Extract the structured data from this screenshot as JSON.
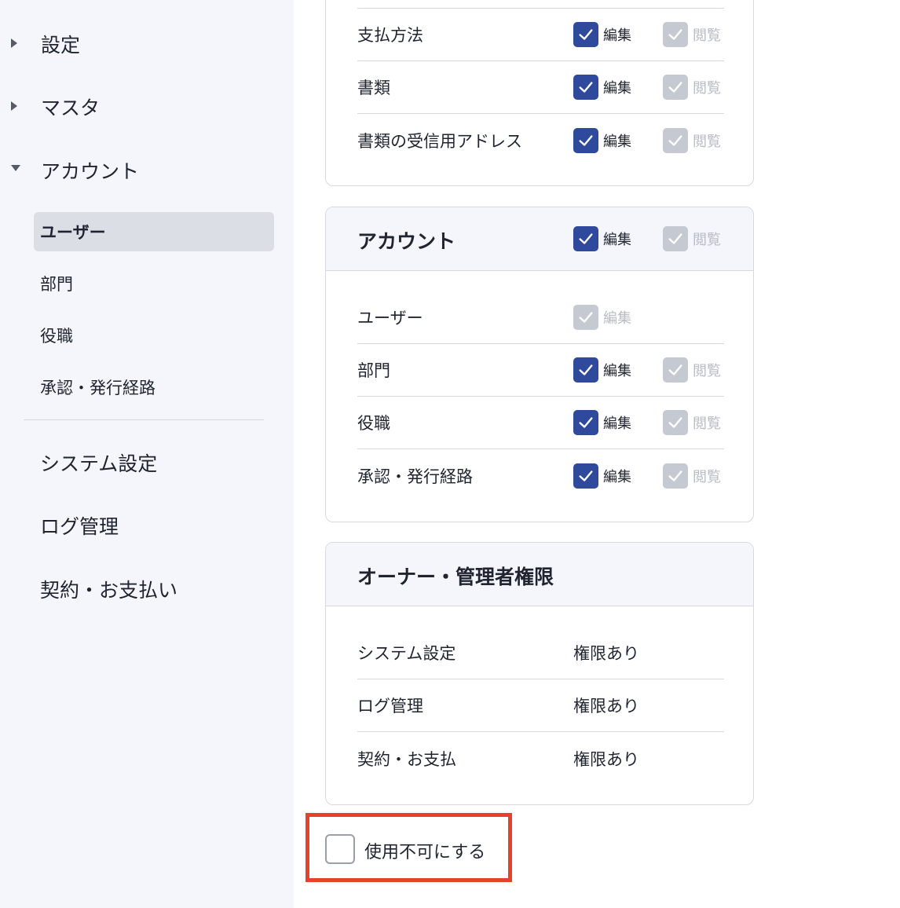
{
  "sidebar": {
    "groups": [
      {
        "label": "設定",
        "state": "collapsed"
      },
      {
        "label": "マスタ",
        "state": "collapsed"
      },
      {
        "label": "アカウント",
        "state": "expanded"
      }
    ],
    "account_items": [
      {
        "label": "ユーザー",
        "active": true
      },
      {
        "label": "部門",
        "active": false
      },
      {
        "label": "役職",
        "active": false
      },
      {
        "label": "承認・発行経路",
        "active": false
      }
    ],
    "other_items": [
      {
        "label": "システム設定"
      },
      {
        "label": "ログ管理"
      },
      {
        "label": "契約・お支払い"
      }
    ]
  },
  "top_card": {
    "rows": [
      {
        "label": "支払方法",
        "edit": "編集",
        "view": "閲覧"
      },
      {
        "label": "書類",
        "edit": "編集",
        "view": "閲覧"
      },
      {
        "label": "書類の受信用アドレス",
        "edit": "編集",
        "view": "閲覧"
      }
    ]
  },
  "account_card": {
    "title": "アカウント",
    "header_edit": "編集",
    "header_view": "閲覧",
    "rows": [
      {
        "label": "ユーザー",
        "edit": "編集"
      },
      {
        "label": "部門",
        "edit": "編集",
        "view": "閲覧"
      },
      {
        "label": "役職",
        "edit": "編集",
        "view": "閲覧"
      },
      {
        "label": "承認・発行経路",
        "edit": "編集",
        "view": "閲覧"
      }
    ]
  },
  "owner_card": {
    "title": "オーナー・管理者権限",
    "rows": [
      {
        "label": "システム設定",
        "value": "権限あり"
      },
      {
        "label": "ログ管理",
        "value": "権限あり"
      },
      {
        "label": "契約・お支払",
        "value": "権限あり"
      }
    ]
  },
  "disable_option": {
    "label": "使用不可にする",
    "checked": false,
    "highlight_color": "#e8412a"
  },
  "colors": {
    "checkbox_checked": "#2f4a9c",
    "checkbox_disabled": "#c5c9d1",
    "sidebar_bg": "#f4f6fb"
  }
}
